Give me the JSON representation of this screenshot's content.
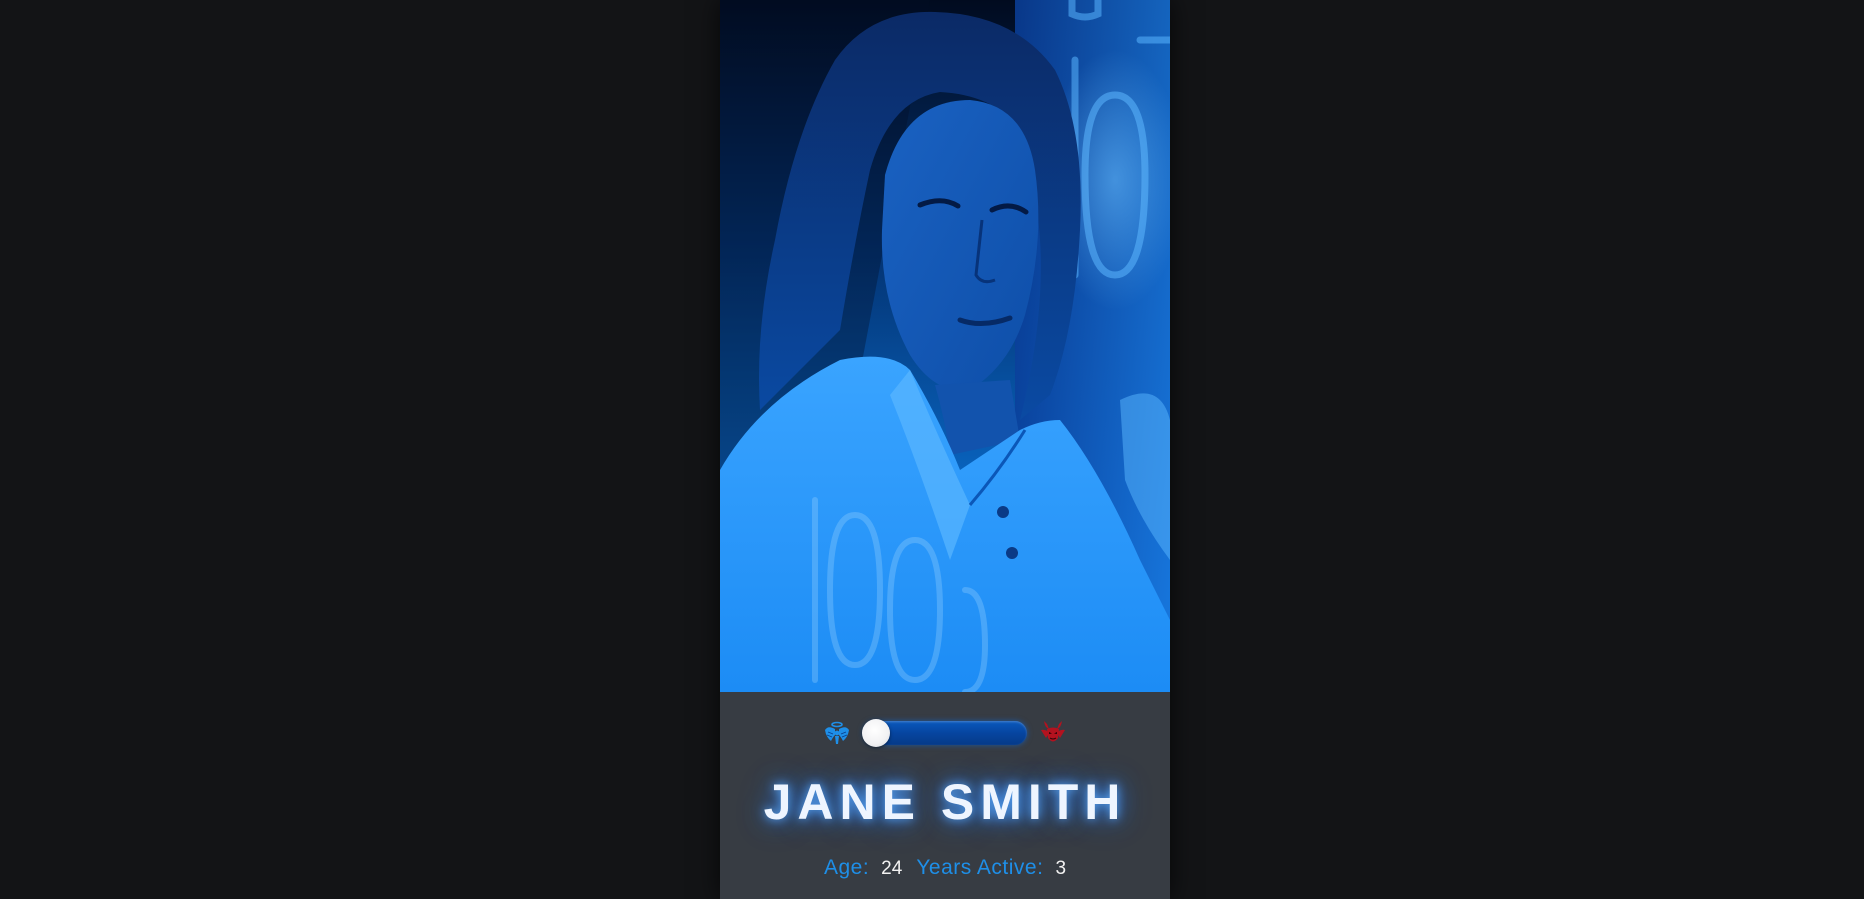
{
  "profile": {
    "name": "JANE SMITH",
    "age_label": "Age:",
    "age_value": "24",
    "years_active_label": "Years Active:",
    "years_active_value": "3"
  },
  "alignment_slider": {
    "left_icon": "angel-icon",
    "right_icon": "demon-icon",
    "value_percent": 8
  },
  "colors": {
    "page_background": "#131416",
    "card_background": "#373c43",
    "accent_blue": "#1e8fe8",
    "track_blue": "#0645a0",
    "demon_red": "#b3121f"
  }
}
